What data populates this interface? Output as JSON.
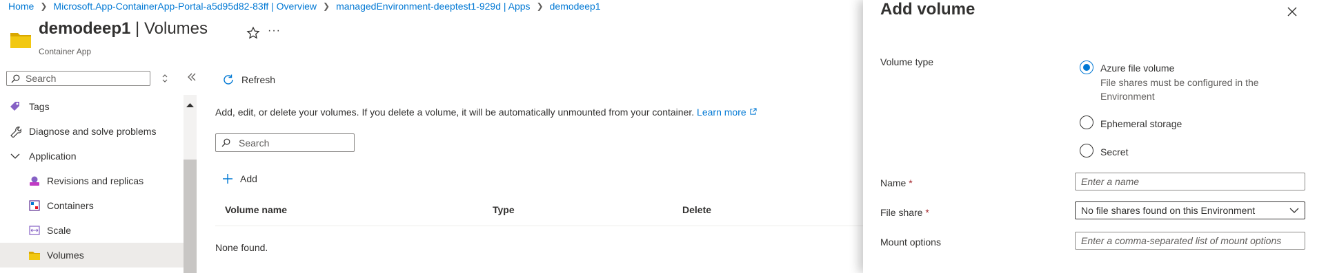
{
  "breadcrumb": {
    "items": [
      "Home",
      "Microsoft.App-ContainerApp-Portal-a5d95d82-83ff | Overview",
      "managedEnvironment-deeptest1-929d | Apps",
      "demodeep1"
    ]
  },
  "header": {
    "resource_name": "demodeep1",
    "separator": " | ",
    "page_name": "Volumes",
    "subtitle": "Container App",
    "favorite_icon": "star-icon",
    "more_icon": "ellipsis-icon"
  },
  "sidebar": {
    "search_placeholder": "Search",
    "items": [
      {
        "label": "Tags",
        "icon": "tag-icon"
      },
      {
        "label": "Diagnose and solve problems",
        "icon": "wrench-icon"
      },
      {
        "label": "Application",
        "icon": "chevron-down-icon"
      },
      {
        "label": "Revisions and replicas",
        "icon": "revisions-icon"
      },
      {
        "label": "Containers",
        "icon": "containers-icon"
      },
      {
        "label": "Scale",
        "icon": "scale-icon"
      },
      {
        "label": "Volumes",
        "icon": "folder-icon",
        "selected": true
      }
    ]
  },
  "toolbar": {
    "refresh_label": "Refresh"
  },
  "main": {
    "description": "Add, edit, or delete your volumes. If you delete a volume, it will be automatically unmounted from your container.",
    "learn_more": "Learn more",
    "search_placeholder": "Search",
    "add_label": "Add",
    "columns": [
      "Volume name",
      "Type",
      "Delete"
    ],
    "empty_text": "None found."
  },
  "panel": {
    "title": "Add volume",
    "volume_type_label": "Volume type",
    "volume_types": [
      {
        "label": "Azure file volume",
        "hint": "File shares must be configured in the Environment",
        "checked": true
      },
      {
        "label": "Ephemeral storage",
        "checked": false
      },
      {
        "label": "Secret",
        "checked": false
      }
    ],
    "name_label": "Name",
    "name_placeholder": "Enter a name",
    "file_share_label": "File share",
    "file_share_value": "No file shares found on this Environment",
    "mount_label": "Mount options",
    "mount_placeholder": "Enter a comma-separated list of mount options",
    "required_marker": "*"
  },
  "colors": {
    "accent": "#0078d4",
    "required": "#a4262c",
    "folder": "#f2c811",
    "selected_bg": "#edebe9"
  }
}
